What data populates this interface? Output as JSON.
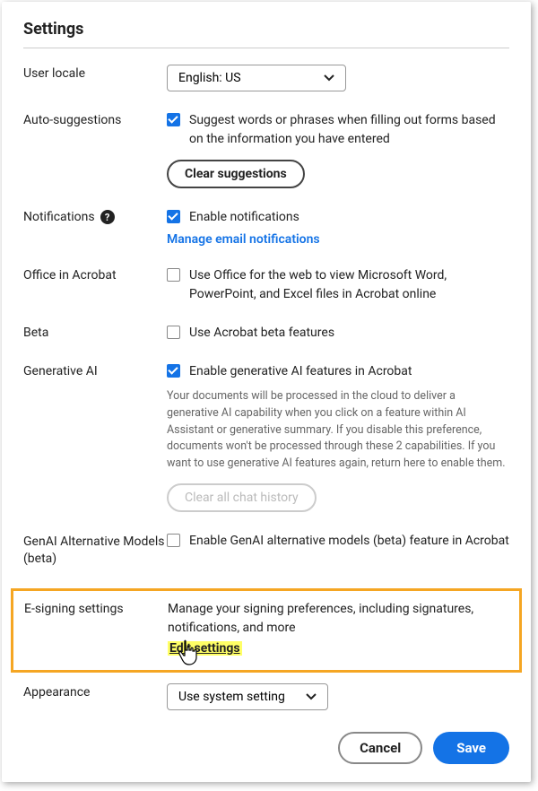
{
  "title": "Settings",
  "locale": {
    "label": "User locale",
    "value": "English: US"
  },
  "autosuggest": {
    "label": "Auto-suggestions",
    "checked": true,
    "text": "Suggest words or phrases when filling out forms based on the information you have entered",
    "clear_btn": "Clear suggestions"
  },
  "notifications": {
    "label": "Notifications",
    "checked": true,
    "text": "Enable notifications",
    "link": "Manage email notifications"
  },
  "office": {
    "label": "Office in Acrobat",
    "checked": false,
    "text": "Use Office for the web to view Microsoft Word, PowerPoint, and Excel files in Acrobat online"
  },
  "beta": {
    "label": "Beta",
    "checked": false,
    "text": "Use Acrobat beta features"
  },
  "genai": {
    "label": "Generative AI",
    "checked": true,
    "text": "Enable generative AI features in Acrobat",
    "desc": "Your documents will be processed in the cloud to deliver a generative AI capability when you click on a feature within AI Assistant or generative summary. If you disable this preference, documents won't be processed through these 2 capabilities. If you want to use generative AI features again, return here to enable them.",
    "clear_btn": "Clear all chat history"
  },
  "genai_alt": {
    "label": "GenAI Alternative Models (beta)",
    "checked": false,
    "text": "Enable GenAI alternative models (beta) feature in Acrobat"
  },
  "esign": {
    "label": "E-signing settings",
    "text": "Manage your signing preferences, including signatures, notifications, and more",
    "link": "Edit settings"
  },
  "appearance": {
    "label": "Appearance",
    "value": "Use system setting"
  },
  "footer": {
    "cancel": "Cancel",
    "save": "Save"
  }
}
